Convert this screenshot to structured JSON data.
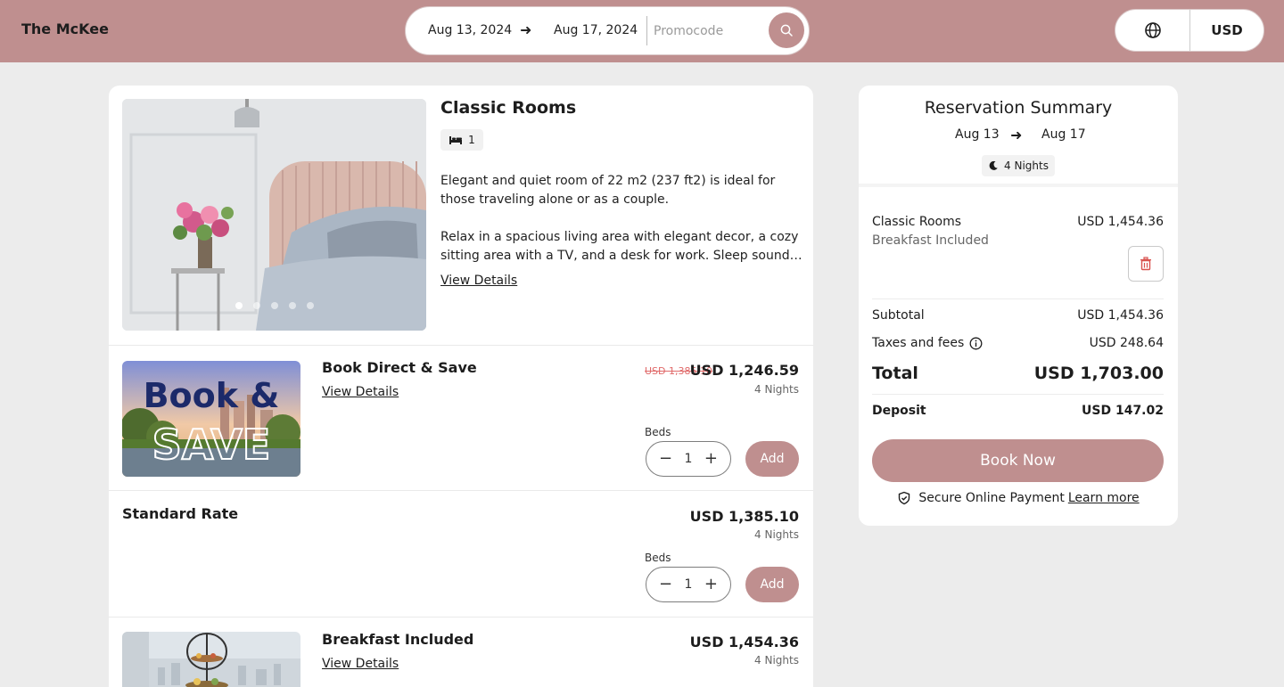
{
  "header": {
    "brand": "The McKee",
    "check_in": "Aug 13, 2024",
    "check_out": "Aug 17, 2024",
    "promocode_placeholder": "Promocode",
    "currency": "USD"
  },
  "room": {
    "title": "Classic Rooms",
    "beds": "1",
    "description_1": "Elegant and quiet room of 22 m2 (237 ft2) is ideal for those traveling alone or as a couple.",
    "description_2a": "Relax in a spacious living area with elegant decor, a cozy",
    "description_2b": "sitting area with a TV, and a desk for work. Sleep soundly...",
    "view_details": "View Details",
    "photo_count": 5,
    "photo_active_index": 0
  },
  "rates": [
    {
      "title": "Book Direct & Save",
      "view_details": "View Details",
      "old_price": "USD 1,385.10",
      "price": "USD 1,246.59",
      "nights": "4 Nights",
      "beds_label": "Beds",
      "beds_value": "1",
      "add_label": "Add",
      "thumb_text_1": "Book &",
      "thumb_text_2": "SAVE"
    },
    {
      "title": "Standard Rate",
      "price": "USD 1,385.10",
      "nights": "4 Nights",
      "beds_label": "Beds",
      "beds_value": "1",
      "add_label": "Add"
    },
    {
      "title": "Breakfast Included",
      "view_details": "View Details",
      "price": "USD 1,454.36",
      "nights": "4 Nights"
    }
  ],
  "summary": {
    "title": "Reservation Summary",
    "from": "Aug 13",
    "to": "Aug 17",
    "nights": "4 Nights",
    "item_name": "Classic Rooms",
    "item_price": "USD 1,454.36",
    "item_rate": "Breakfast Included",
    "subtotal_label": "Subtotal",
    "subtotal_value": "USD 1,454.36",
    "taxes_label": "Taxes and fees",
    "taxes_value": "USD 248.64",
    "total_label": "Total",
    "total_value": "USD 1,703.00",
    "deposit_label": "Deposit",
    "deposit_value": "USD 147.02",
    "book_label": "Book Now",
    "secure_text": "Secure Online Payment",
    "learn_more": "Learn more"
  },
  "colors": {
    "accent": "#bf8f8f",
    "background": "#ececec",
    "strike_price": "#e06a6a"
  }
}
